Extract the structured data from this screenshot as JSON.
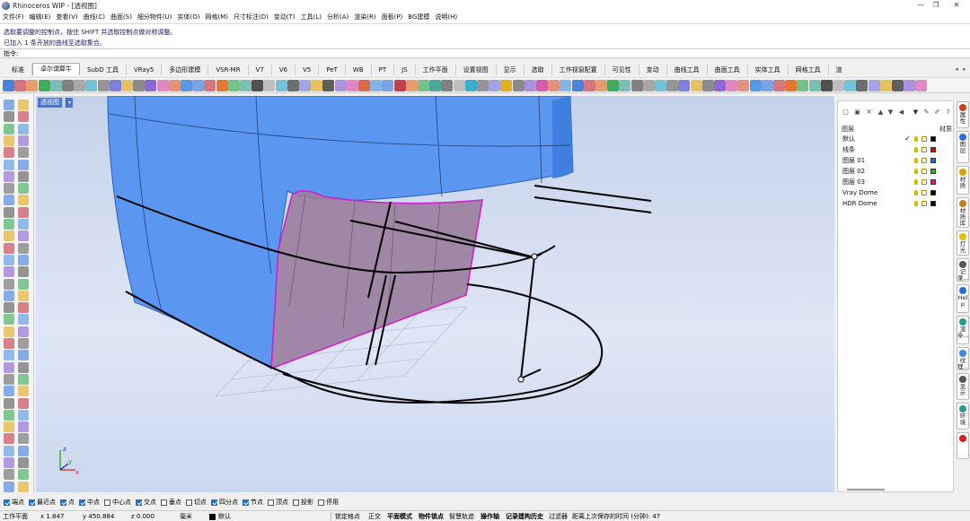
{
  "window": {
    "title": "Rhinoceros WIP - [透视图]",
    "controls": [
      "—",
      "❐",
      "✕"
    ]
  },
  "menu": [
    "文件(F)",
    "编辑(E)",
    "查看(V)",
    "曲线(C)",
    "曲面(S)",
    "细分物件(U)",
    "实体(O)",
    "网格(M)",
    "尺寸标注(D)",
    "变动(T)",
    "工具(L)",
    "分析(A)",
    "渲染(R)",
    "面板(P)",
    "BG建模",
    "说明(H)"
  ],
  "command_history": [
    "选取要调整的控制点，按住 SHIFT 并选取控制点做对称调整。",
    "已加入 1 条开放的曲线至选取集合。"
  ],
  "command_prompt": "指令:",
  "tabs": [
    "标准",
    "卓尔谓犀牛",
    "SubD 工具",
    "VRay5",
    "多边形建模",
    "VSR-MR",
    "V7",
    "V6",
    "V5",
    "PeT",
    "WB",
    "PT",
    "JS",
    "工作平面",
    "设置视图",
    "显示",
    "选取",
    "工作视窗配置",
    "可见性",
    "变动",
    "曲线工具",
    "曲面工具",
    "实体工具",
    "网格工具",
    "渲"
  ],
  "active_tab": "卓尔谓犀牛",
  "viewport": {
    "label": "透视图",
    "dropdown": "▾",
    "axis_x": "x",
    "axis_y": "y",
    "axis_z": "z"
  },
  "layers_panel": {
    "header_layer": "图层",
    "header_material": "材质",
    "rows": [
      {
        "name": "默认",
        "current": "✓",
        "color": "#000000"
      },
      {
        "name": "线条",
        "current": "",
        "color": "#e00000"
      },
      {
        "name": "图层 01",
        "current": "",
        "color": "#1f6fd0"
      },
      {
        "name": "图层 02",
        "current": "",
        "color": "#2ab52a"
      },
      {
        "name": "图层 03",
        "current": "",
        "color": "#e0157a"
      },
      {
        "name": "Vray Dome",
        "current": "",
        "color": "#000000"
      },
      {
        "name": "HDR Dome",
        "current": "",
        "color": "#000000"
      }
    ]
  },
  "side_tabs": [
    "属性",
    "图层",
    "材质",
    "材质库",
    "灯光",
    "记录...",
    "Help",
    "渲染...",
    "纹理...",
    "显示",
    "环境",
    ""
  ],
  "osnaps": [
    {
      "label": "端点",
      "on": true
    },
    {
      "label": "最近点",
      "on": true
    },
    {
      "label": "点",
      "on": true
    },
    {
      "label": "中点",
      "on": true
    },
    {
      "label": "中心点",
      "on": false
    },
    {
      "label": "交点",
      "on": true
    },
    {
      "label": "垂点",
      "on": false
    },
    {
      "label": "切点",
      "on": false
    },
    {
      "label": "四分点",
      "on": true
    },
    {
      "label": "节点",
      "on": true
    },
    {
      "label": "顶点",
      "on": false
    },
    {
      "label": "投影",
      "on": false
    },
    {
      "label": "停用",
      "on": false
    }
  ],
  "status": {
    "cplane": "工作平面",
    "x": "x 1.847",
    "y": "y 450.884",
    "z": "z 0.000",
    "units": "毫米",
    "layer": "默认",
    "grid_snap": "锁定格点",
    "ortho": "正交",
    "planar": "平面模式",
    "osnap": "物件锁点",
    "smarttrack": "智慧轨迹",
    "gumball": "操作轴",
    "history": "记录建构历史",
    "filter": "过滤器",
    "autosave": "距离上次保存的时间 (分钟): 47"
  },
  "colors": {
    "accent": "#4a76d8",
    "surface_blue": "#5b97f0",
    "selected_magenta": "#d020d0",
    "viewport_bg": "#d8e0f2"
  }
}
